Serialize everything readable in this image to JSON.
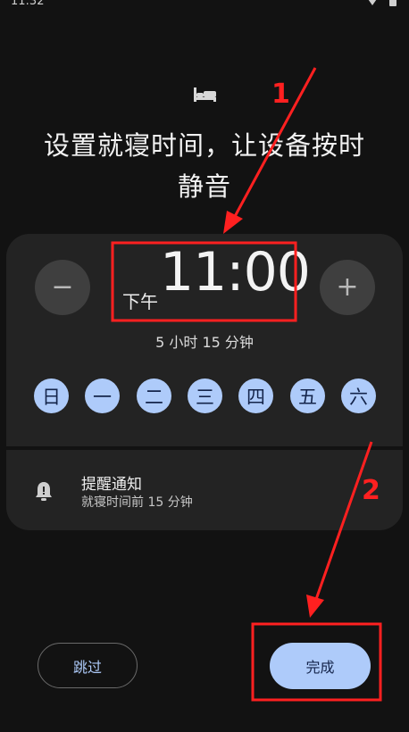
{
  "status_bar": {
    "time": "11:32"
  },
  "header": {
    "title_line1": "设置就寝时间，让设备按时",
    "title_line2": "静音"
  },
  "time_picker": {
    "decrease_symbol": "−",
    "increase_symbol": "+",
    "ampm": "下午",
    "time": "11:00",
    "duration": "5 小时 15 分钟"
  },
  "days": [
    "日",
    "一",
    "二",
    "三",
    "四",
    "五",
    "六"
  ],
  "reminder": {
    "title": "提醒通知",
    "subtitle": "就寝时间前 15 分钟"
  },
  "actions": {
    "skip_label": "跳过",
    "done_label": "完成"
  },
  "annotations": {
    "marker1": "1",
    "marker2": "2",
    "color": "#ff2020"
  },
  "colors": {
    "accent": "#aecbfa",
    "background": "#121212",
    "card": "#232323"
  }
}
